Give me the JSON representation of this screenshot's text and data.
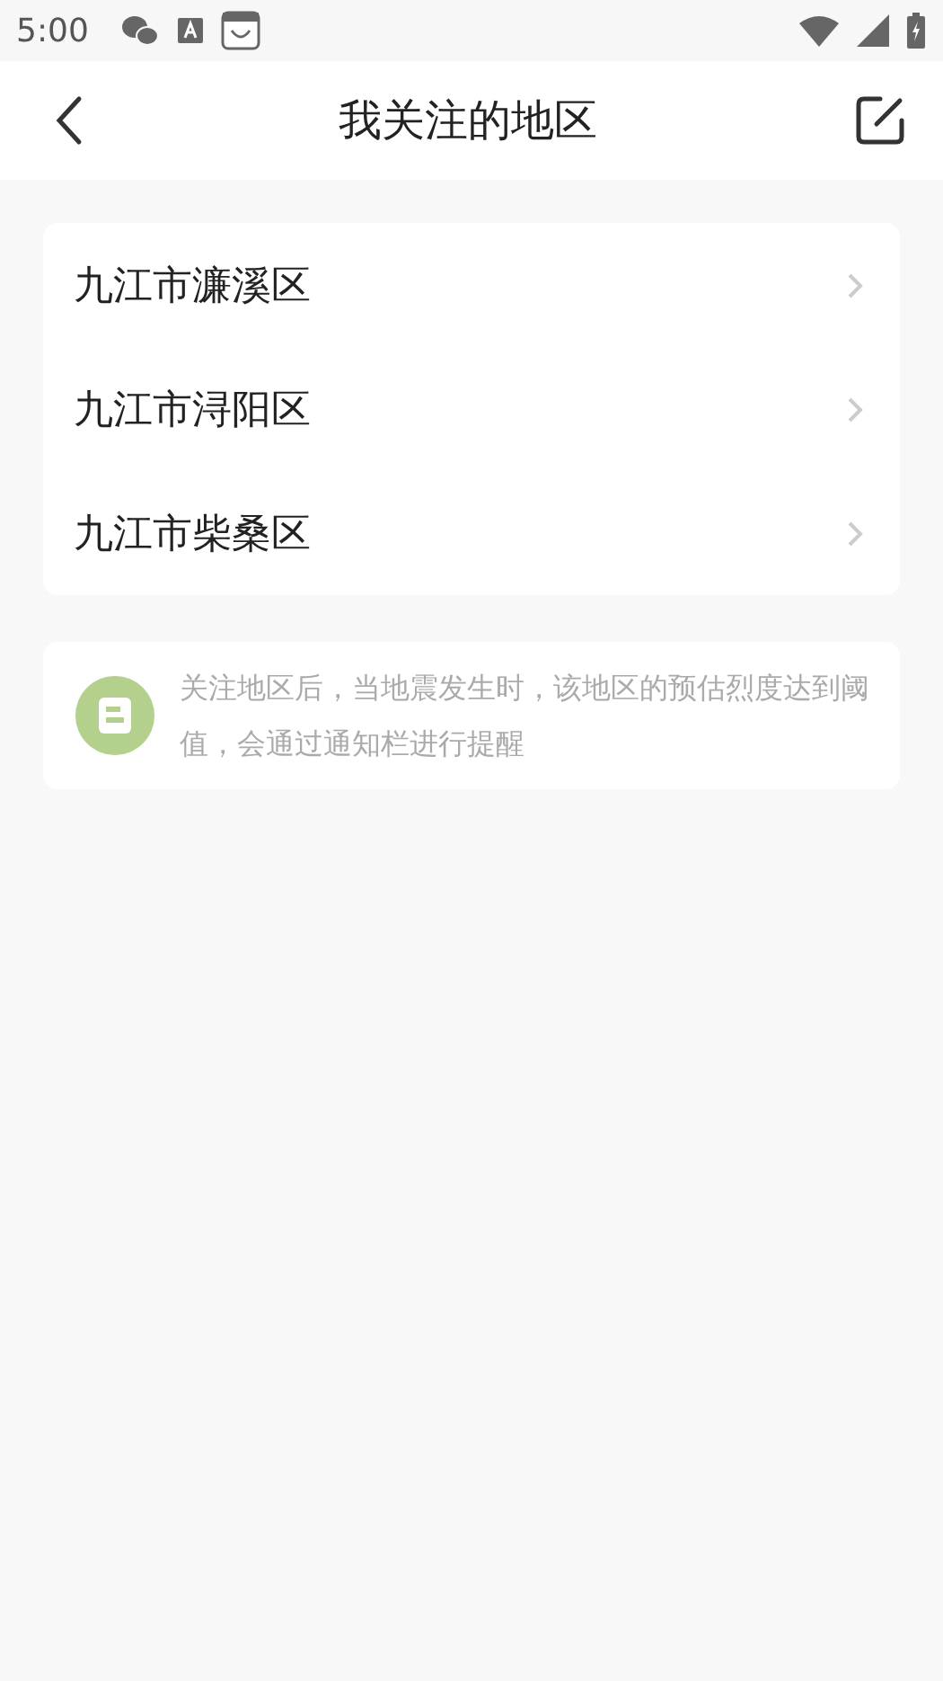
{
  "status_bar": {
    "time": "5:00"
  },
  "header": {
    "title": "我关注的地区"
  },
  "regions": [
    {
      "name": "九江市濂溪区"
    },
    {
      "name": "九江市浔阳区"
    },
    {
      "name": "九江市柴桑区"
    }
  ],
  "notice": {
    "text": "关注地区后，当地震发生时，该地区的预估烈度达到阈值，会通过通知栏进行提醒"
  }
}
